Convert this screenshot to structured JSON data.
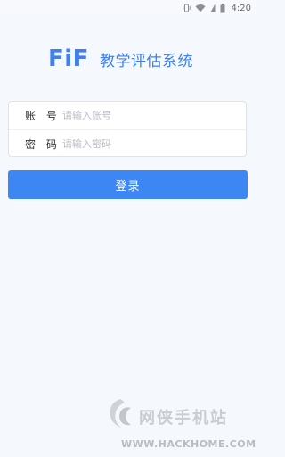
{
  "status_bar": {
    "time": "4:20",
    "icons": [
      "vibrate-icon",
      "wifi-icon",
      "signal-icon",
      "battery-icon"
    ]
  },
  "header": {
    "logo": "FiF",
    "title": "教学评估系统"
  },
  "form": {
    "account_label": "账 号",
    "account_placeholder": "请输入账号",
    "password_label": "密 码",
    "password_placeholder": "请输入密码"
  },
  "login_button": {
    "label": "登录"
  },
  "watermark": {
    "title": "网侠手机站",
    "url": "WWW.HACKHOME.COM"
  },
  "colors": {
    "accent": "#3c87f3",
    "background": "#f5f8fd",
    "logo_blue": "#3f7ff0"
  }
}
